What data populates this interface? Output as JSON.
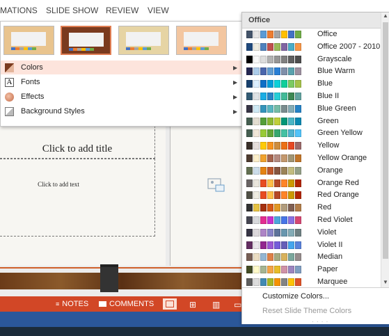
{
  "ribbon_tabs": [
    {
      "label": "MATIONS"
    },
    {
      "label": "SLIDE SHOW"
    },
    {
      "label": "REVIEW"
    },
    {
      "label": "VIEW"
    }
  ],
  "slide": {
    "title_placeholder": "Click to add title",
    "text_placeholder": "Click to add text"
  },
  "variants": [
    {
      "bg": "#e9c48e",
      "selected": false
    },
    {
      "bg": "#7a3a1e",
      "selected": true
    },
    {
      "bg": "#e6d4a4",
      "selected": false
    },
    {
      "bg": "#f3c6a0",
      "selected": false
    }
  ],
  "variant_swatches": [
    "#4472c4",
    "#ed7d31",
    "#a5a5a5",
    "#ffc000",
    "#5b9bd5",
    "#70ad47"
  ],
  "menu": {
    "items": [
      {
        "label": "Colors",
        "icon": "colors-icon"
      },
      {
        "label": "Fonts",
        "icon": "fonts-icon"
      },
      {
        "label": "Effects",
        "icon": "effects-icon"
      },
      {
        "label": "Background Styles",
        "icon": "background-styles-icon"
      }
    ],
    "hovered": "Colors"
  },
  "colors_panel": {
    "header": "Office",
    "schemes": [
      {
        "name": "Office",
        "swatches": [
          "#44546a",
          "#e7e6e6",
          "#5b9bd5",
          "#ed7d31",
          "#a5a5a5",
          "#ffc000",
          "#4472c4",
          "#70ad47"
        ]
      },
      {
        "name": "Office 2007 - 2010",
        "swatches": [
          "#1f497d",
          "#eeece1",
          "#4f81bd",
          "#c0504d",
          "#9bbb59",
          "#8064a2",
          "#4bacc6",
          "#f79646"
        ]
      },
      {
        "name": "Grayscale",
        "swatches": [
          "#000000",
          "#f8f8f8",
          "#dddddd",
          "#b2b2b2",
          "#969696",
          "#808080",
          "#5f5f5f",
          "#4d4d4d"
        ]
      },
      {
        "name": "Blue Warm",
        "swatches": [
          "#242852",
          "#acccea",
          "#4a66ac",
          "#629dd1",
          "#297fd5",
          "#7f8fa9",
          "#5aa2ae",
          "#9d90a0"
        ]
      },
      {
        "name": "Blue",
        "swatches": [
          "#17406d",
          "#dbefff",
          "#0f6fc6",
          "#009dd9",
          "#0bd0d9",
          "#10cf9b",
          "#7cca62",
          "#a5c249"
        ]
      },
      {
        "name": "Blue II",
        "swatches": [
          "#335b74",
          "#dfe3e5",
          "#1cade4",
          "#2683c6",
          "#27ced7",
          "#42ba97",
          "#3e8853",
          "#62a39f"
        ]
      },
      {
        "name": "Blue Green",
        "swatches": [
          "#373545",
          "#cee9f4",
          "#3494ba",
          "#58b6c0",
          "#75bda7",
          "#7a8c8e",
          "#84acb6",
          "#2683c6"
        ]
      },
      {
        "name": "Green",
        "swatches": [
          "#455f51",
          "#e3ded1",
          "#549e39",
          "#8ab833",
          "#c0cf3a",
          "#029676",
          "#4ab5c4",
          "#0989b1"
        ]
      },
      {
        "name": "Green Yellow",
        "swatches": [
          "#455f51",
          "#f1e7d8",
          "#99cb38",
          "#63a537",
          "#37a76f",
          "#44c1a3",
          "#4eb3cf",
          "#51c3f9"
        ]
      },
      {
        "name": "Yellow",
        "swatches": [
          "#39302a",
          "#e5dedb",
          "#ffca08",
          "#f8931d",
          "#ce8d3e",
          "#ec7016",
          "#e64823",
          "#9c6a6a"
        ]
      },
      {
        "name": "Yellow Orange",
        "swatches": [
          "#4e3b30",
          "#fbeec9",
          "#f0a22e",
          "#a5644e",
          "#b58b80",
          "#c3986d",
          "#a19574",
          "#c17529"
        ]
      },
      {
        "name": "Orange",
        "swatches": [
          "#637052",
          "#ccddea",
          "#e48312",
          "#bd582c",
          "#865640",
          "#9b8357",
          "#c2bc80",
          "#94a088"
        ]
      },
      {
        "name": "Orange Red",
        "swatches": [
          "#696464",
          "#e9e5dc",
          "#e84c22",
          "#ffbd47",
          "#b64926",
          "#ff8427",
          "#cc9900",
          "#b22600"
        ]
      },
      {
        "name": "Red Orange",
        "swatches": [
          "#505046",
          "#eeece1",
          "#e84c22",
          "#ffbd47",
          "#b64926",
          "#ff8427",
          "#cc9900",
          "#b22600"
        ]
      },
      {
        "name": "Red",
        "swatches": [
          "#323232",
          "#e5c243",
          "#a5300f",
          "#d55816",
          "#e19825",
          "#b19c7d",
          "#7f5f52",
          "#b27d49"
        ]
      },
      {
        "name": "Red Violet",
        "swatches": [
          "#454551",
          "#d8d9dc",
          "#e32d91",
          "#c830cc",
          "#4ea6dc",
          "#4775e7",
          "#8971e1",
          "#d54773"
        ]
      },
      {
        "name": "Violet",
        "swatches": [
          "#373545",
          "#dcd8dc",
          "#ad84c6",
          "#8784c7",
          "#5d739a",
          "#6997af",
          "#84acb6",
          "#6f8183"
        ]
      },
      {
        "name": "Violet II",
        "swatches": [
          "#632e62",
          "#eae5eb",
          "#92278f",
          "#9b57d3",
          "#755dd9",
          "#665eb8",
          "#45a5ed",
          "#5982db"
        ]
      },
      {
        "name": "Median",
        "swatches": [
          "#775f55",
          "#ebddc3",
          "#94b6d2",
          "#dd8047",
          "#a5ab81",
          "#d8b25c",
          "#7ba79d",
          "#968c8c"
        ]
      },
      {
        "name": "Paper",
        "swatches": [
          "#444d26",
          "#fefac9",
          "#a5b592",
          "#f3a447",
          "#e7bc29",
          "#d092a7",
          "#9c85c0",
          "#809ec2"
        ]
      },
      {
        "name": "Marquee",
        "swatches": [
          "#5e5e5e",
          "#dddddd",
          "#418ab3",
          "#a6b727",
          "#f69200",
          "#838383",
          "#fec306",
          "#df5327"
        ]
      }
    ],
    "footer": {
      "customize": "Customize Colors...",
      "reset": "Reset Slide Theme Colors"
    }
  },
  "status_bar": {
    "notes": "NOTES",
    "comments": "COMMENTS"
  },
  "colors": {
    "accent": "#d24726",
    "hover": "#fde4dc",
    "selected_border": "#e07d52"
  }
}
